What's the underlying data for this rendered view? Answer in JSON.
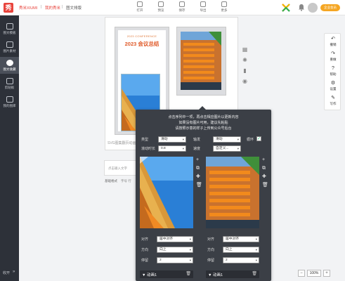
{
  "header": {
    "logo_char": "秀",
    "breadcrumb": [
      "秀米XIUMI",
      "我的秀米",
      "图文排版"
    ],
    "separator": "|",
    "tools": [
      {
        "label": "打开",
        "icon": "folder-icon"
      },
      {
        "label": "预览",
        "icon": "preview-icon"
      },
      {
        "label": "保存",
        "icon": "save-icon"
      },
      {
        "label": "导出",
        "icon": "export-icon"
      },
      {
        "label": "更多",
        "icon": "more-icon"
      }
    ],
    "vip_label": "企业会员"
  },
  "sidebar": {
    "items": [
      {
        "label": "图文模板",
        "icon": "template-icon"
      },
      {
        "label": "图片素材",
        "icon": "image-icon"
      },
      {
        "label": "图文收藏",
        "icon": "favorite-icon",
        "active": true
      },
      {
        "label": "剪贴板",
        "icon": "clipboard-icon"
      },
      {
        "label": "我的图库",
        "icon": "gallery-icon"
      }
    ],
    "collapse_label": "收开",
    "collapse_icon": "»"
  },
  "canvas": {
    "conference_en": "2023 CONFERENCE",
    "conference_title": "2023 会议总结",
    "caption": "SVG图集翻页动画组件",
    "text_placeholder": "点击输入文字",
    "base_label": "基础格式",
    "base_label2": "字号  行"
  },
  "right_toolbar": [
    {
      "label": "撤销",
      "icon": "undo-icon",
      "glyph": "↶"
    },
    {
      "label": "重做",
      "icon": "redo-icon",
      "glyph": "↷"
    },
    {
      "label": "帮助",
      "icon": "help-icon",
      "glyph": "?"
    },
    {
      "label": "设置",
      "icon": "settings-icon",
      "glyph": "⚙"
    },
    {
      "label": "写作",
      "icon": "write-icon",
      "glyph": "✎"
    }
  ],
  "zoom": {
    "minus": "−",
    "value": "100%",
    "plus": "+"
  },
  "popup": {
    "tips": [
      "点击序列中一项，再点击相应图片以更新内容",
      "如果没有图片可用，建议先粘贴",
      "请按照示意的样子上传到公众号后台"
    ],
    "type_label": "类型",
    "type_value": "滑动",
    "axis_label": "轴发",
    "axis_value": "滑动",
    "loop_label": "循环",
    "loop_checked": "✓",
    "duration_label": "滚动时长",
    "duration_value": "0.8",
    "speed_label": "速度",
    "speed_value": "自定义...",
    "frames": [
      {
        "align_label": "对齐",
        "align_value": "居中对齐",
        "dir_label": "方向",
        "dir_value": "向上",
        "stop_label": "停留",
        "stop_value": "2",
        "title": "动画1"
      },
      {
        "align_label": "对齐",
        "align_value": "居中对齐",
        "dir_label": "方向",
        "dir_value": "向上",
        "stop_label": "停留",
        "stop_value": "2",
        "title": "动画1"
      }
    ],
    "side_icons": [
      "+",
      "⧉",
      "✚",
      "🗑"
    ]
  }
}
